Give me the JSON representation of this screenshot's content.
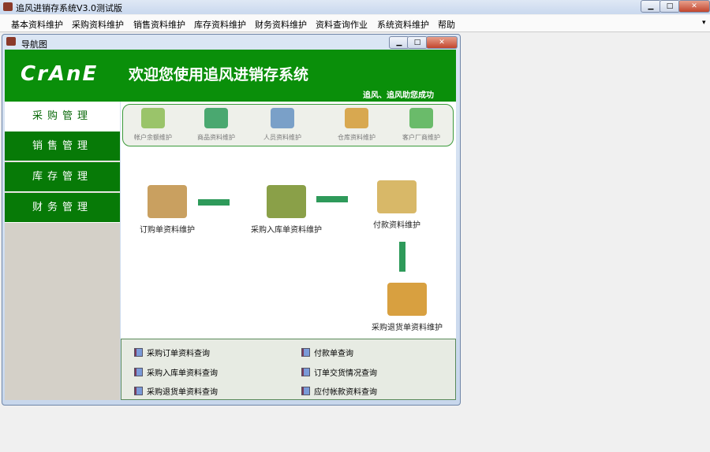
{
  "app": {
    "title": "追风进销存系统V3.0测试版"
  },
  "menu": [
    "基本资料维护",
    "采购资料维护",
    "销售资料维护",
    "库存资料维护",
    "财务资料维护",
    "资料查询作业",
    "系统资料维护",
    "帮助"
  ],
  "child": {
    "title": "导航图"
  },
  "header": {
    "logo": "CrAnE",
    "welcome": "欢迎您使用追风进销存系统",
    "slogan": "追风、追风助您成功"
  },
  "sidebar": [
    "采购管理",
    "销售管理",
    "库存管理",
    "财务管理"
  ],
  "tools": [
    "帐户余额维护",
    "商品资料维护",
    "人员资料维护",
    "仓库资料维护",
    "客户厂商维护"
  ],
  "flow": [
    "订购单资料维护",
    "采购入库单资料维护",
    "付款资料维护",
    "采购退货单资料维护"
  ],
  "queries": [
    "采购订单资料查询",
    "付款单查询",
    "采购入库单资料查询",
    "订单交货情况查询",
    "采购退货单资料查询",
    "应付帐款资料查询"
  ]
}
